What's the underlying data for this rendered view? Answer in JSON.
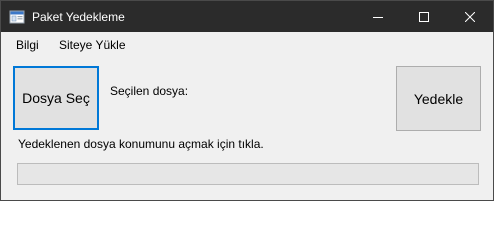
{
  "window": {
    "title": "Paket Yedekleme",
    "icons": {
      "app": "application-icon",
      "minimize": "minimize-icon",
      "maximize": "maximize-icon",
      "close": "close-icon"
    }
  },
  "menu": {
    "items": [
      {
        "label": "Bilgi"
      },
      {
        "label": "Siteye Yükle"
      }
    ]
  },
  "main": {
    "select_file_button": "Dosya Seç",
    "selected_file_label": "Seçilen dosya:",
    "selected_file_value": "",
    "backup_button": "Yedekle",
    "open_location_hint": "Yedeklenen dosya konumunu açmak için tıkla.",
    "progress": 0
  },
  "colors": {
    "titlebar": "#2b2b2b",
    "window_bg": "#f0f0f0",
    "button_bg": "#e1e1e1",
    "focus_border": "#0078d7"
  }
}
